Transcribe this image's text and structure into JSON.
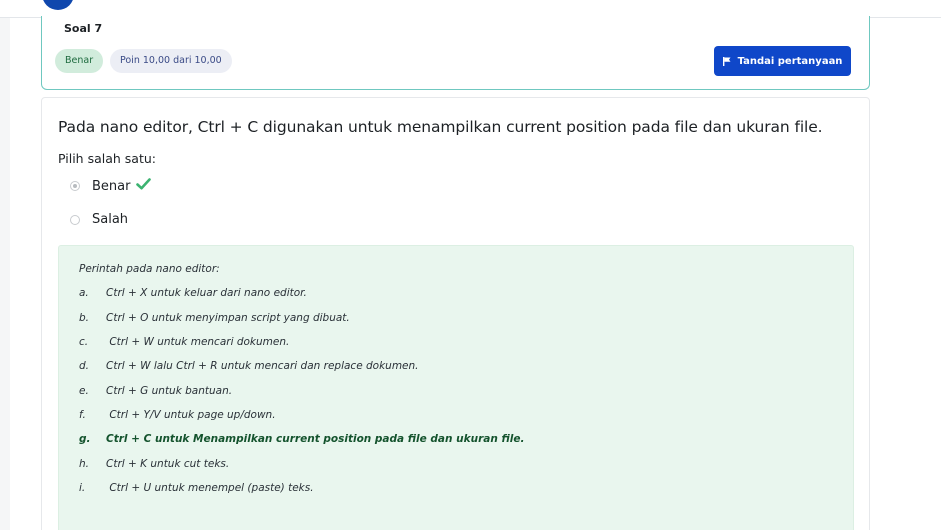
{
  "info": {
    "question_label": "Soal 7",
    "state_badge": "Benar",
    "points_badge": "Poin 10,00 dari 10,00",
    "flag_button": "Tandai pertanyaan"
  },
  "question": {
    "text": "Pada nano editor, Ctrl + C digunakan untuk menampilkan current position pada file dan ukuran file.",
    "prompt": "Pilih salah satu:",
    "options": [
      {
        "label": "Benar",
        "selected": true,
        "correct": true
      },
      {
        "label": "Salah",
        "selected": false
      }
    ]
  },
  "feedback": {
    "heading": "Perintah pada nano editor:",
    "items": [
      {
        "letter": "a.",
        "text": "Ctrl + X untuk keluar dari nano editor."
      },
      {
        "letter": "b.",
        "text": "Ctrl + O untuk menyimpan script yang dibuat."
      },
      {
        "letter": "c.",
        "text": " Ctrl + W untuk mencari dokumen."
      },
      {
        "letter": "d.",
        "text": "Ctrl + W lalu Ctrl + R untuk mencari dan replace dokumen."
      },
      {
        "letter": "e.",
        "text": "Ctrl + G untuk bantuan."
      },
      {
        "letter": "f.",
        "text": " Ctrl + Y/V untuk page up/down."
      },
      {
        "letter": "g.",
        "text": "Ctrl + C untuk Menampilkan current position pada file dan ukuran file."
      },
      {
        "letter": "h.",
        "text": "Ctrl + K untuk cut teks."
      },
      {
        "letter": "i.",
        "text": " Ctrl + U untuk menempel (paste) teks."
      }
    ]
  },
  "colors": {
    "accent": "#0f47c9",
    "correct_bg": "#d1ecdc",
    "feedback_bg": "#e9f6ee",
    "card_border": "#6fc8c0",
    "check": "#3cb371"
  }
}
